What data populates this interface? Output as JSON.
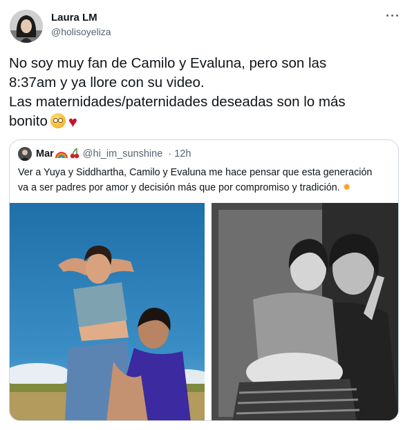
{
  "tweet": {
    "author_name": "Laura LM",
    "author_handle": "@holisoyeliza",
    "text_lines": [
      "No soy muy fan de Camilo y Evaluna, pero son las",
      "8:37am y ya llore con su video.",
      "Las maternidades/paternidades deseadas son lo más",
      "bonito"
    ],
    "emojis": [
      "rolling-eyes-face-emoji",
      "red-heart-emoji"
    ]
  },
  "quoted_tweet": {
    "author_name": "Mar",
    "author_emojis": [
      "rainbow-emoji",
      "cherries-emoji"
    ],
    "author_handle": "@hi_im_sunshine",
    "separator": "·",
    "time": "12h",
    "text_lines": [
      "Ver a Yuya y Siddhartha, Camilo y Evaluna me hace pensar que esta generación",
      "va a ser padres por amor y decisión más que por compromiso y tradición."
    ],
    "trailing_emoji": "sun-emoji",
    "media": [
      "photo-couple-outdoor",
      "photo-couple-bw"
    ]
  },
  "colors": {
    "text": "#0f1419",
    "secondary_text": "#536471",
    "border": "#cfd9de",
    "heart": "#c8102e"
  }
}
